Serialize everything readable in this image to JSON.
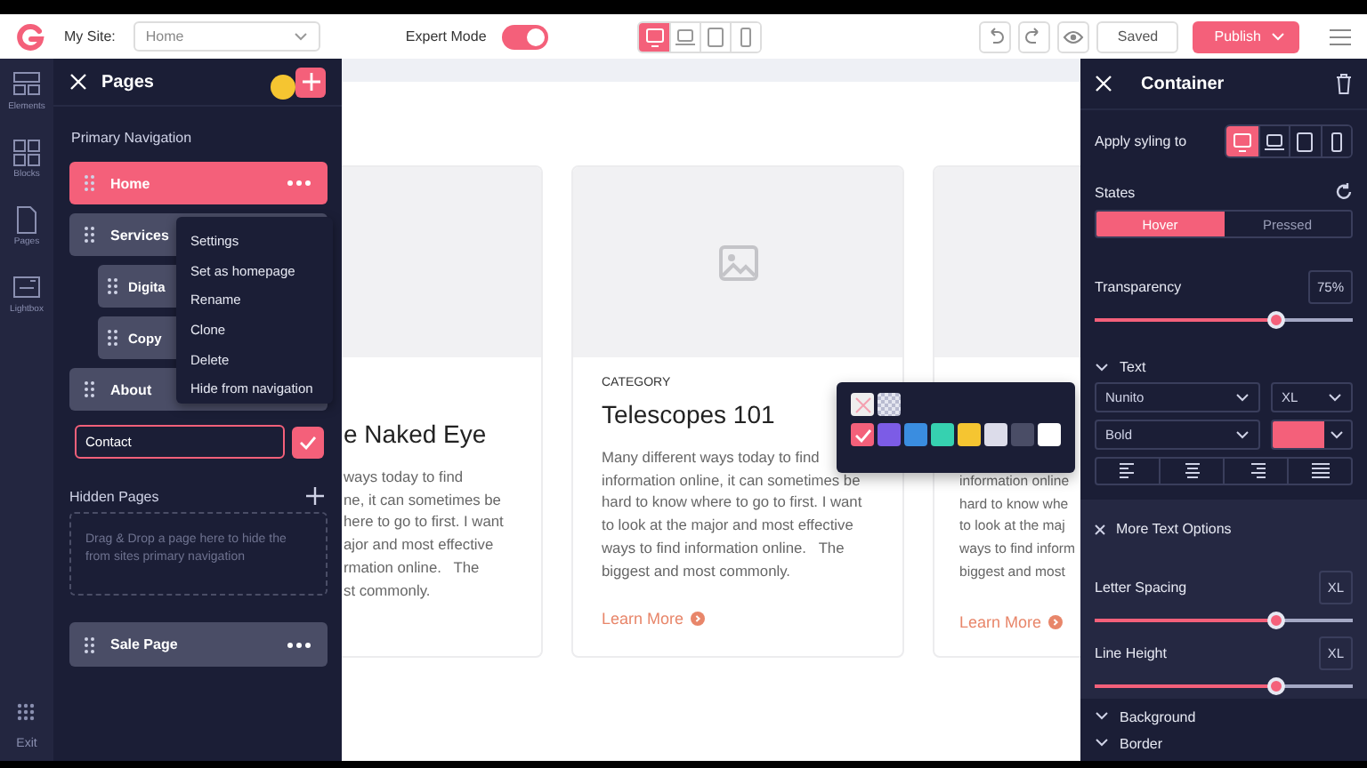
{
  "toolbar": {
    "site_label": "My Site:",
    "site_select": "Home",
    "expert_mode": {
      "label": "Expert Mode",
      "on": true
    },
    "devices": [
      {
        "kind": "desktop",
        "selected": true
      },
      {
        "kind": "laptop",
        "selected": false
      },
      {
        "kind": "tablet",
        "selected": false
      },
      {
        "kind": "phone",
        "selected": false
      }
    ],
    "saved": "Saved",
    "publish": "Publish"
  },
  "rail": {
    "items": [
      {
        "label": "Elements",
        "kind": "elements"
      },
      {
        "label": "Blocks",
        "kind": "blocks"
      },
      {
        "label": "Pages",
        "kind": "pages"
      },
      {
        "label": "Lightbox",
        "kind": "lightbox"
      }
    ],
    "exit": "Exit"
  },
  "pages_panel": {
    "title": "Pages",
    "primary_label": "Primary Navigation",
    "pages": [
      {
        "label": "Home",
        "selected": true,
        "menu": true
      },
      {
        "label": "Services",
        "selected": false,
        "children": [
          {
            "label": "Digita",
            "selected": false
          },
          {
            "label": "Copy",
            "selected": false
          }
        ]
      },
      {
        "label": "About",
        "selected": false
      }
    ],
    "context_menu": [
      "Settings",
      "Set as homepage",
      "Rename",
      "Clone",
      "Delete",
      "Hide from navigation"
    ],
    "rename_field": {
      "value": "Contact"
    },
    "hidden_label": "Hidden Pages",
    "drop_hint": "Drag & Drop a page here to hide the from sites primary navigation",
    "hidden_pages": [
      {
        "label": "Sale Page",
        "selected": false,
        "menu": true
      }
    ]
  },
  "canvas": {
    "cards": [
      {
        "kind": "cut_left",
        "title": "e Naked Eye",
        "body": "ways today to find\nne, it can sometimes be\nhere to go to first. I want\najor and most effective\nrmation online.   The\nst commonly."
      },
      {
        "kind": "full",
        "category": "CATEGORY",
        "title": "Telescopes 101",
        "body": "Many different ways today to find\ninformation online, it can sometimes be\nhard to know where to go to first. I want\nto look at the major and most effective\nways to find information online.   The\nbiggest and most commonly.",
        "learn_more": "Learn More"
      },
      {
        "kind": "covered",
        "body": "information online\nhard to know whe\nto look at the maj\nways to find inform\nbiggest and most",
        "learn_more": "Learn More"
      }
    ],
    "color_picker": {
      "special": [
        {
          "kind": "none"
        },
        {
          "kind": "transparent"
        }
      ],
      "swatches": [
        {
          "color": "#f4607a",
          "selected": true
        },
        {
          "color": "#7c5ce6",
          "selected": false
        },
        {
          "color": "#3a8de0",
          "selected": false
        },
        {
          "color": "#36d1b0",
          "selected": false
        },
        {
          "color": "#f5c531",
          "selected": false
        },
        {
          "color": "#dcdcea",
          "selected": false
        },
        {
          "color": "#4a4d66",
          "selected": false
        },
        {
          "color": "#ffffff",
          "selected": false
        }
      ]
    }
  },
  "container_panel": {
    "title": "Container",
    "apply_label": "Apply syling to",
    "devices": [
      {
        "kind": "desktop",
        "selected": true
      },
      {
        "kind": "laptop",
        "selected": false
      },
      {
        "kind": "tablet",
        "selected": false
      },
      {
        "kind": "phone",
        "selected": false
      }
    ],
    "states_label": "States",
    "states": [
      {
        "label": "Hover",
        "selected": true
      },
      {
        "label": "Pressed",
        "selected": false
      }
    ],
    "transparency": {
      "label": "Transparency",
      "value": "75%",
      "level": 0.7
    },
    "text_section": {
      "label": "Text",
      "font": "Nunito",
      "size": "XL",
      "weight": "Bold",
      "color": "#f4607a",
      "align": [
        {
          "kind": "left"
        },
        {
          "kind": "center"
        },
        {
          "kind": "right"
        },
        {
          "kind": "justify"
        }
      ]
    },
    "more_text": {
      "label": "More Text Options",
      "letter_spacing": {
        "label": "Letter Spacing",
        "value": "XL",
        "level": 0.7
      },
      "line_height": {
        "label": "Line Height",
        "value": "XL",
        "level": 0.7
      }
    },
    "collapsed_sections": [
      "Background",
      "Border"
    ]
  }
}
